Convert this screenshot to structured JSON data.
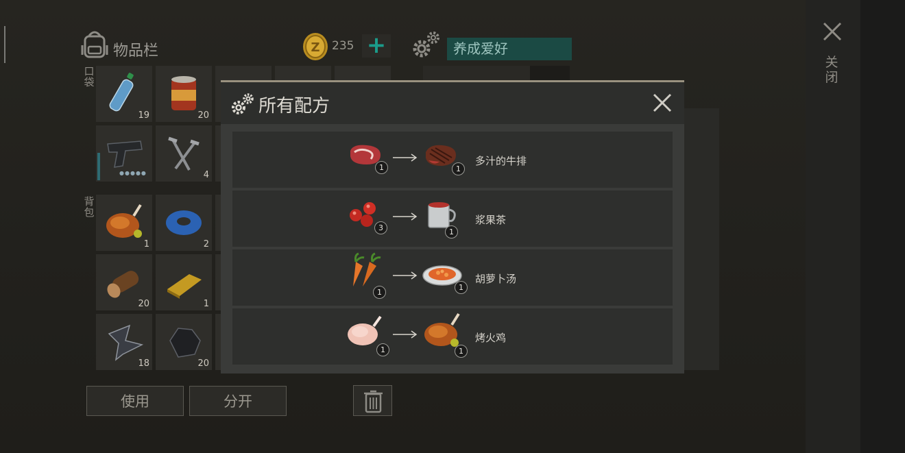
{
  "inventory": {
    "title": "物品栏",
    "pocket_label": "口袋",
    "backpack_label": "背包",
    "coins": "235",
    "add_coins_symbol": "+",
    "hobby": "养成爱好",
    "slots": [
      {
        "item": "water-bottle",
        "count": "19"
      },
      {
        "item": "canned-food",
        "count": "20"
      },
      {
        "item": "pistol",
        "count": ""
      },
      {
        "item": "nails",
        "count": "4"
      },
      {
        "item": "roast-chicken",
        "count": "1"
      },
      {
        "item": "blue-tape",
        "count": "2"
      },
      {
        "item": "wood-log",
        "count": "20"
      },
      {
        "item": "gold-bar",
        "count": "1"
      },
      {
        "item": "scrap-metal",
        "count": "18"
      },
      {
        "item": "coal",
        "count": "20"
      }
    ]
  },
  "actions": {
    "use": "使用",
    "split": "分开"
  },
  "close_label": "关闭",
  "modal": {
    "title": "所有配方",
    "recipes": [
      {
        "input": "raw-steak",
        "input_count": "1",
        "output": "cooked-steak",
        "output_count": "1",
        "name": "多汁的牛排"
      },
      {
        "input": "berries",
        "input_count": "3",
        "output": "berry-tea-mug",
        "output_count": "1",
        "name": "浆果茶"
      },
      {
        "input": "carrots",
        "input_count": "1",
        "output": "carrot-soup",
        "output_count": "1",
        "name": "胡萝卜汤"
      },
      {
        "input": "raw-chicken",
        "input_count": "1",
        "output": "roast-chicken",
        "output_count": "1",
        "name": "烤火鸡"
      }
    ]
  },
  "colors": {
    "accent_teal": "#1b9b8a",
    "hobby_bg": "#1b4a44",
    "modal_border": "#9a9280"
  }
}
